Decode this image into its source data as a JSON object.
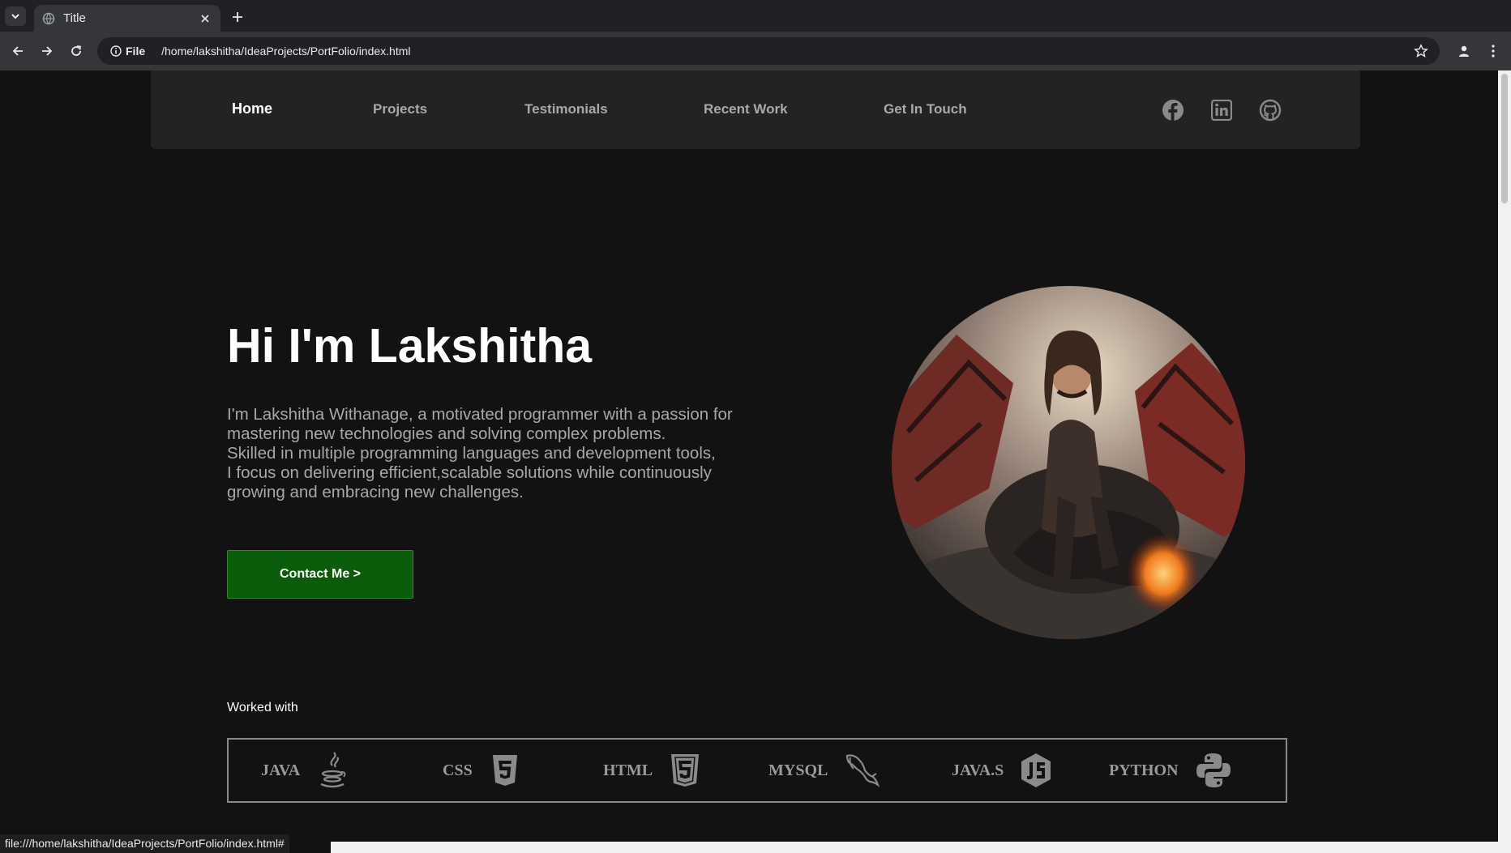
{
  "browser": {
    "tab_title": "Title",
    "omnibox_label": "File",
    "url": "/home/lakshitha/IdeaProjects/PortFolio/index.html",
    "status_url": "file:///home/lakshitha/IdeaProjects/PortFolio/index.html#"
  },
  "nav": {
    "links": [
      "Home",
      "Projects",
      "Testimonials",
      "Recent Work",
      "Get In Touch"
    ],
    "active": "Home",
    "social_icons": [
      "facebook-icon",
      "linkedin-icon",
      "github-icon"
    ]
  },
  "hero": {
    "title": "Hi I'm Lakshitha",
    "description_lines": [
      "I'm Lakshitha Withanage, a motivated programmer with a passion for",
      "mastering new technologies and solving complex problems.",
      "Skilled in multiple programming languages and development tools,",
      "I focus on delivering efficient,scalable solutions while continuously",
      "growing and embracing new challenges."
    ],
    "cta_label": "Contact Me >",
    "cta_color": "#0a5c0a"
  },
  "skills": {
    "label": "Worked with",
    "items": [
      {
        "name": "JAVA",
        "icon": "java-icon"
      },
      {
        "name": "CSS",
        "icon": "css3-icon"
      },
      {
        "name": "HTML",
        "icon": "html5-icon"
      },
      {
        "name": "MYSQL",
        "icon": "mysql-dolphin-icon"
      },
      {
        "name": "JAVA.S",
        "icon": "javascript-icon"
      },
      {
        "name": "PYTHON",
        "icon": "python-icon"
      }
    ]
  },
  "colors": {
    "page_bg": "#121212",
    "navbar_bg": "#232323",
    "nav_inactive": "#a9a9a9",
    "accent_green": "#0a5c0a"
  }
}
